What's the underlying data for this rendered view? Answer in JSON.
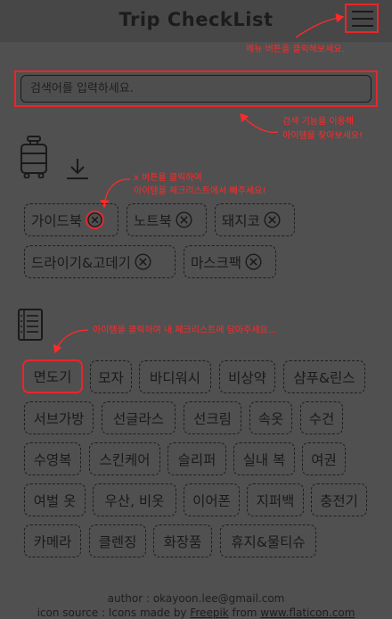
{
  "header": {
    "title": "Trip CheckList"
  },
  "annotations": {
    "menu": "메뉴 버튼을 클릭해보세요.",
    "search_1": "검색 기능을 이용해",
    "search_2": "아이템을 찾아보세요!",
    "remove_1": "x 버튼을 클릭하여",
    "remove_2": "아이템을 체크리스트에서 빼주세요!",
    "add": "아이템을 클릭하여 내 체크리스트에 담아주세요..."
  },
  "search": {
    "placeholder": "검색어를 입력하세요."
  },
  "checklist": {
    "icons": [
      "luggage-icon",
      "download-icon"
    ],
    "items": [
      {
        "label": "가이드북"
      },
      {
        "label": "노트북"
      },
      {
        "label": "돼지코"
      },
      {
        "label": "드라이기&고데기"
      },
      {
        "label": "마스크팩"
      }
    ]
  },
  "catalog": {
    "icon": "list-icon",
    "items": [
      "면도기",
      "모자",
      "바디워시",
      "비상약",
      "샴푸&린스",
      "서브가방",
      "선글라스",
      "선크림",
      "속옷",
      "수건",
      "수영복",
      "스킨케어",
      "슬리퍼",
      "실내 복",
      "여권",
      "여벌 옷",
      "우산, 비옷",
      "이어폰",
      "지퍼백",
      "충전기",
      "카메라",
      "클렌징",
      "화장품",
      "휴지&물티슈"
    ]
  },
  "footer": {
    "author": "author : okayoon.lee@gmail.com",
    "icon_prefix": "icon source : Icons made by ",
    "icon_author": "Freepik",
    "icon_mid": " from ",
    "icon_site": "www.flaticon.com"
  },
  "colors": {
    "accent": "#e8262a",
    "annotation": "#ff2a2a",
    "background": "#505050",
    "header": "#474747"
  }
}
